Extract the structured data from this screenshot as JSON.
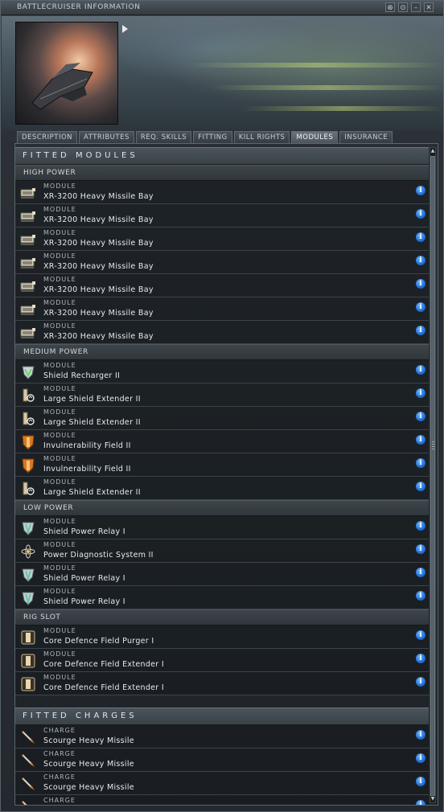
{
  "window": {
    "title": "BATTLECRUISER INFORMATION",
    "buttons": [
      "⊗",
      "⊙",
      "–",
      "✕"
    ]
  },
  "tabs": [
    {
      "label": "DESCRIPTION"
    },
    {
      "label": "ATTRIBUTES"
    },
    {
      "label": "REQ. SKILLS"
    },
    {
      "label": "FITTING"
    },
    {
      "label": "KILL RIGHTS"
    },
    {
      "label": "MODULES",
      "active": true
    },
    {
      "label": "INSURANCE"
    }
  ],
  "sections": {
    "fitted_modules": "FITTED MODULES",
    "fitted_charges": "FITTED CHARGES"
  },
  "groups": {
    "high_power": {
      "label": "HIGH POWER",
      "items": [
        {
          "kind": "MODULE",
          "name": "XR-3200 Heavy Missile Bay",
          "icon": "missile-bay-icon"
        },
        {
          "kind": "MODULE",
          "name": "XR-3200 Heavy Missile Bay",
          "icon": "missile-bay-icon"
        },
        {
          "kind": "MODULE",
          "name": "XR-3200 Heavy Missile Bay",
          "icon": "missile-bay-icon"
        },
        {
          "kind": "MODULE",
          "name": "XR-3200 Heavy Missile Bay",
          "icon": "missile-bay-icon"
        },
        {
          "kind": "MODULE",
          "name": "XR-3200 Heavy Missile Bay",
          "icon": "missile-bay-icon"
        },
        {
          "kind": "MODULE",
          "name": "XR-3200 Heavy Missile Bay",
          "icon": "missile-bay-icon"
        },
        {
          "kind": "MODULE",
          "name": "XR-3200 Heavy Missile Bay",
          "icon": "missile-bay-icon"
        }
      ]
    },
    "medium_power": {
      "label": "MEDIUM POWER",
      "items": [
        {
          "kind": "MODULE",
          "name": "Shield Recharger II",
          "icon": "shield-recharger-icon"
        },
        {
          "kind": "MODULE",
          "name": "Large Shield Extender II",
          "icon": "shield-extender-icon"
        },
        {
          "kind": "MODULE",
          "name": "Large Shield Extender II",
          "icon": "shield-extender-icon"
        },
        {
          "kind": "MODULE",
          "name": "Invulnerability Field II",
          "icon": "invulnerability-field-icon"
        },
        {
          "kind": "MODULE",
          "name": "Invulnerability Field II",
          "icon": "invulnerability-field-icon"
        },
        {
          "kind": "MODULE",
          "name": "Large Shield Extender II",
          "icon": "shield-extender-icon"
        }
      ]
    },
    "low_power": {
      "label": "LOW POWER",
      "items": [
        {
          "kind": "MODULE",
          "name": "Shield Power Relay I",
          "icon": "shield-relay-icon"
        },
        {
          "kind": "MODULE",
          "name": "Power Diagnostic System II",
          "icon": "power-diagnostic-icon"
        },
        {
          "kind": "MODULE",
          "name": "Shield Power Relay I",
          "icon": "shield-relay-icon"
        },
        {
          "kind": "MODULE",
          "name": "Shield Power Relay I",
          "icon": "shield-relay-icon"
        }
      ]
    },
    "rig_slot": {
      "label": "RIG SLOT",
      "items": [
        {
          "kind": "MODULE",
          "name": "Core Defence Field Purger I",
          "icon": "rig-icon"
        },
        {
          "kind": "MODULE",
          "name": "Core Defence Field Extender I",
          "icon": "rig-icon"
        },
        {
          "kind": "MODULE",
          "name": "Core Defence Field Extender I",
          "icon": "rig-icon"
        }
      ]
    }
  },
  "charges": [
    {
      "kind": "CHARGE",
      "name": "Scourge Heavy Missile",
      "icon": "missile-icon"
    },
    {
      "kind": "CHARGE",
      "name": "Scourge Heavy Missile",
      "icon": "missile-icon"
    },
    {
      "kind": "CHARGE",
      "name": "Scourge Heavy Missile",
      "icon": "missile-icon"
    },
    {
      "kind": "CHARGE",
      "name": "",
      "icon": "missile-icon"
    }
  ],
  "info_glyph": "i",
  "colors": {
    "info_blue": "#1f6fd6",
    "shield_orange": "#d9781e",
    "shield_green": "#6fd46f"
  }
}
